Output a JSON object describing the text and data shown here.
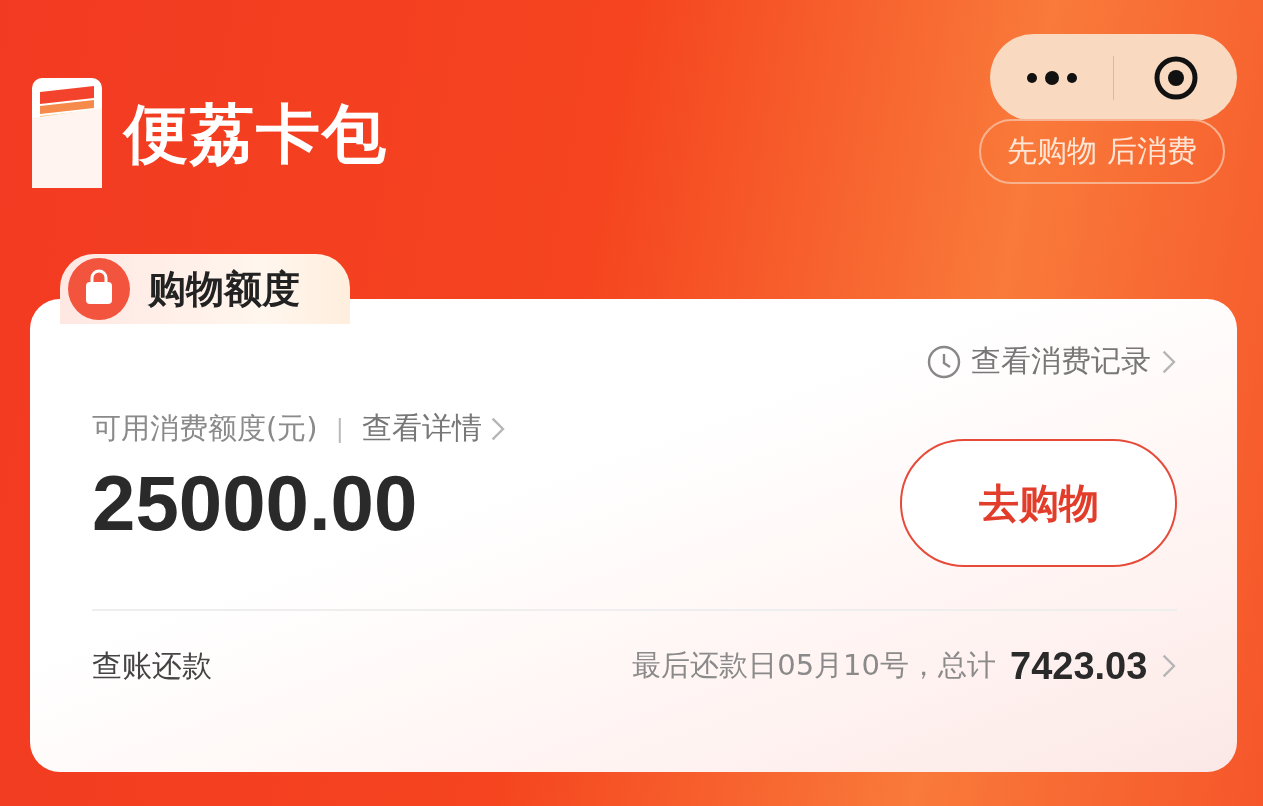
{
  "header": {
    "title": "便荔卡包",
    "slogan": "先购物 后消费"
  },
  "quota": {
    "tab_label": "购物额度",
    "history_link": "查看消费记录",
    "available_label": "可用消费额度(元)",
    "separator": "|",
    "details_link": "查看详情",
    "amount": "25000.00",
    "shop_button": "去购物"
  },
  "billing": {
    "label": "查账还款",
    "due_text": "最后还款日05月10号，总计",
    "total": "7423.03"
  }
}
